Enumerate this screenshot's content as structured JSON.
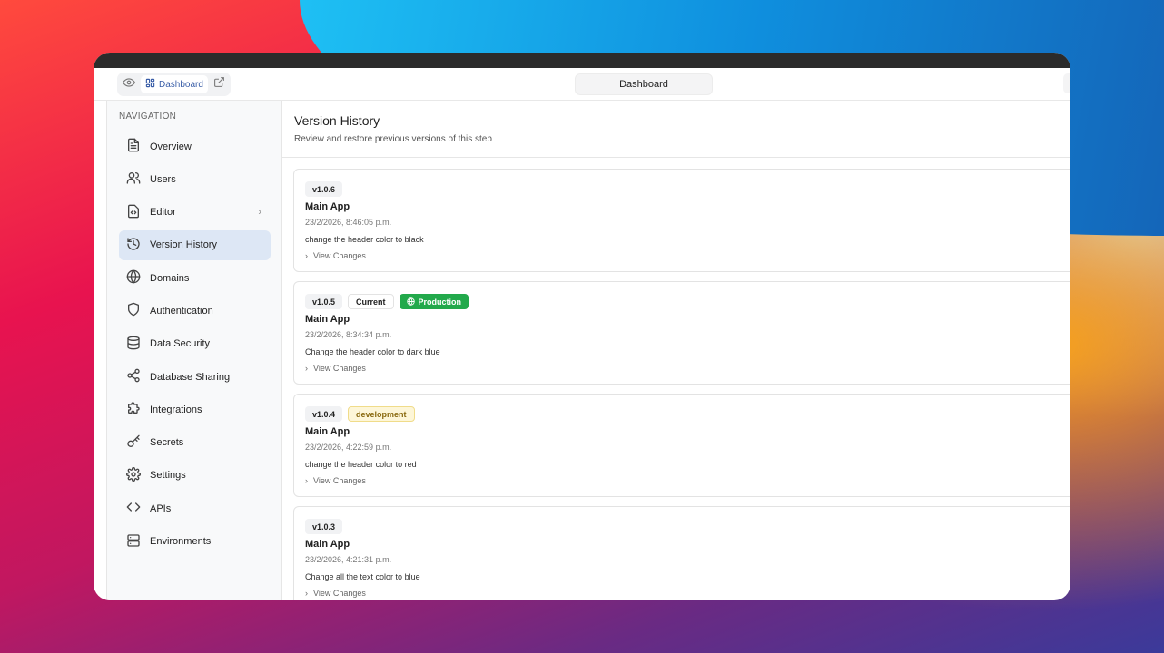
{
  "header": {
    "pill_label": "Dashboard",
    "center_tab": "Dashboard"
  },
  "sidebar": {
    "section_label": "NAVIGATION",
    "items": [
      {
        "label": "Overview",
        "icon": "file-text-icon"
      },
      {
        "label": "Users",
        "icon": "users-icon"
      },
      {
        "label": "Editor",
        "icon": "code-file-icon"
      },
      {
        "label": "Version History",
        "icon": "history-icon"
      },
      {
        "label": "Domains",
        "icon": "globe-icon"
      },
      {
        "label": "Authentication",
        "icon": "shield-icon"
      },
      {
        "label": "Data Security",
        "icon": "database-icon"
      },
      {
        "label": "Database Sharing",
        "icon": "share-icon"
      },
      {
        "label": "Integrations",
        "icon": "puzzle-icon"
      },
      {
        "label": "Secrets",
        "icon": "key-icon"
      },
      {
        "label": "Settings",
        "icon": "gear-icon"
      },
      {
        "label": "APIs",
        "icon": "code-icon"
      },
      {
        "label": "Environments",
        "icon": "server-icon"
      }
    ],
    "active": "Version History"
  },
  "main": {
    "title": "Version History",
    "subtitle": "Review and restore previous versions of this step",
    "view_changes_label": "View Changes",
    "versions": [
      {
        "version": "v1.0.6",
        "app": "Main App",
        "date": "23/2/2026, 8:46:05 p.m.",
        "description": "change the header color to black"
      },
      {
        "version": "v1.0.5",
        "current": "Current",
        "env": "Production",
        "app": "Main App",
        "date": "23/2/2026, 8:34:34 p.m.",
        "description": "Change the header color to dark blue"
      },
      {
        "version": "v1.0.4",
        "env": "development",
        "app": "Main App",
        "date": "23/2/2026, 4:22:59 p.m.",
        "description": "change the header color to red"
      },
      {
        "version": "v1.0.3",
        "app": "Main App",
        "date": "23/2/2026, 4:21:31 p.m.",
        "description": "Change all the text color to blue"
      }
    ]
  },
  "colors": {
    "production": "#22a94b",
    "active_nav": "#dde7f5",
    "accent": "#3b5fa8"
  }
}
